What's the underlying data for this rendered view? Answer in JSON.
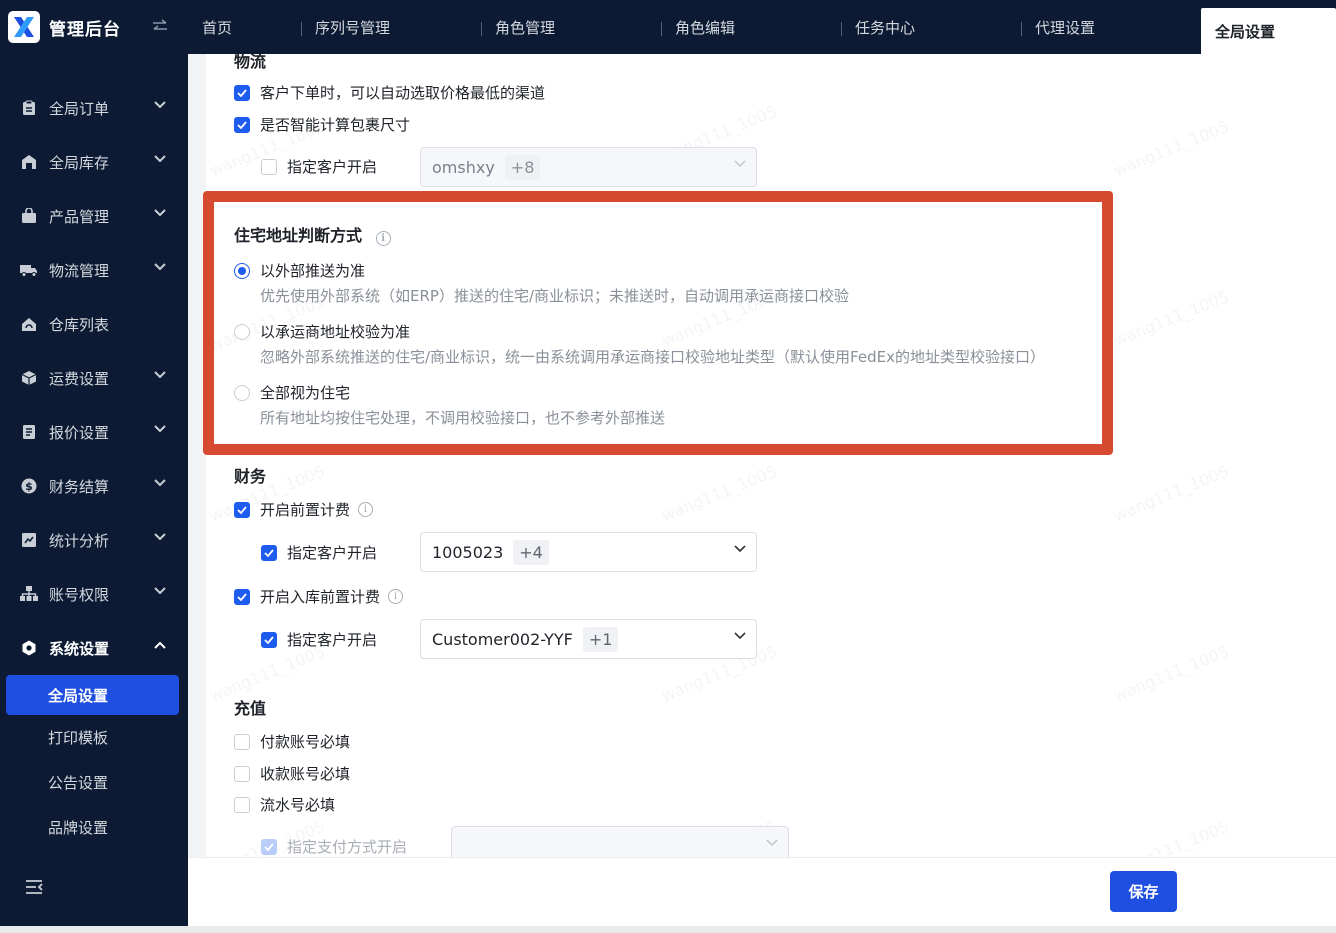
{
  "app": {
    "title": "管理后台"
  },
  "tabs": [
    "首页",
    "序列号管理",
    "角色管理",
    "角色编辑",
    "任务中心",
    "代理设置",
    "全局设置"
  ],
  "sidebar": {
    "items": [
      {
        "label": "全局订单",
        "icon": "clipboard-icon"
      },
      {
        "label": "全局库存",
        "icon": "warehouse-icon"
      },
      {
        "label": "产品管理",
        "icon": "bag-icon"
      },
      {
        "label": "物流管理",
        "icon": "truck-icon"
      },
      {
        "label": "仓库列表",
        "icon": "home-icon"
      },
      {
        "label": "运费设置",
        "icon": "box-icon"
      },
      {
        "label": "报价设置",
        "icon": "document-icon"
      },
      {
        "label": "财务结算",
        "icon": "dollar-icon"
      },
      {
        "label": "统计分析",
        "icon": "chart-icon"
      },
      {
        "label": "账号权限",
        "icon": "org-icon"
      },
      {
        "label": "系统设置",
        "icon": "settings-icon"
      }
    ],
    "submenu": [
      "全局设置",
      "打印模板",
      "公告设置",
      "品牌设置"
    ]
  },
  "logistics": {
    "title": "物流",
    "option1": "客户下单时，可以自动选取价格最低的渠道",
    "option2": "是否智能计算包裹尺寸",
    "specify_label": "指定客户开启",
    "specify_value": "omshxy",
    "specify_more": "+8"
  },
  "residential": {
    "title": "住宅地址判断方式",
    "options": [
      {
        "label": "以外部推送为准",
        "desc": "优先使用外部系统（如ERP）推送的住宅/商业标识；未推送时，自动调用承运商接口校验"
      },
      {
        "label": "以承运商地址校验为准",
        "desc": "忽略外部系统推送的住宅/商业标识，统一由系统调用承运商接口校验地址类型（默认使用FedEx的地址类型校验接口）"
      },
      {
        "label": "全部视为住宅",
        "desc": "所有地址均按住宅处理，不调用校验接口，也不参考外部推送"
      }
    ]
  },
  "finance": {
    "title": "财务",
    "prebill": "开启前置计费",
    "specify1_label": "指定客户开启",
    "specify1_value": "1005023",
    "specify1_more": "+4",
    "inbound_prebill": "开启入库前置计费",
    "specify2_label": "指定客户开启",
    "specify2_value": "Customer002-YYF",
    "specify2_more": "+1"
  },
  "recharge": {
    "title": "充值",
    "option1": "付款账号必填",
    "option2": "收款账号必填",
    "option3": "流水号必填",
    "specify_label": "指定支付方式开启"
  },
  "watermark": "wang111_1005",
  "footer": {
    "save": "保存"
  },
  "colors": {
    "accent": "#1e5cf0",
    "sidebar": "#0c1b33",
    "highlight": "#d64a2f"
  }
}
